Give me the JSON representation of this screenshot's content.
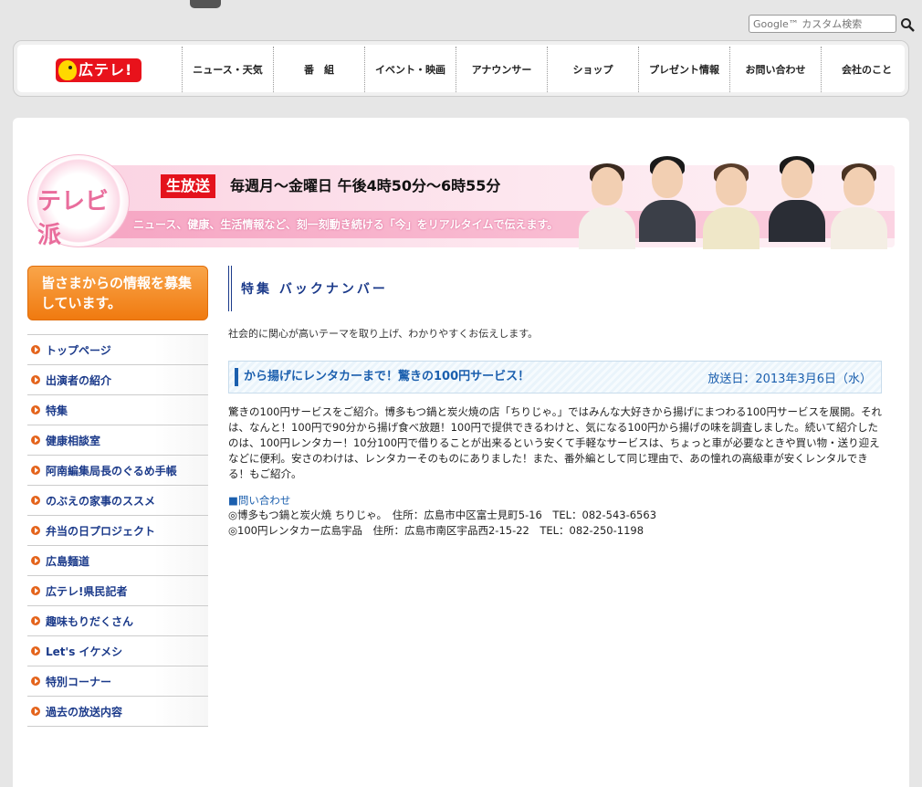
{
  "search": {
    "placeholder": "Google™ カスタム検索"
  },
  "logo": {
    "text": "広テレ!"
  },
  "nav": [
    "ニュース・天気",
    "番　組",
    "イベント・映画",
    "アナウンサー",
    "ショップ",
    "プレゼント情報",
    "お問い合わせ",
    "会社のこと"
  ],
  "banner": {
    "program_name": "テレビ派",
    "live_label": "生放送",
    "schedule": "毎週月～金曜日 午後4時50分～6時55分",
    "tagline": "ニュース、健康、生活情報など、刻一刻動き続ける「今」をリアルタイムで伝えます。"
  },
  "sidebar": {
    "info_banner": "皆さまからの情報を募集しています。",
    "items": [
      "トップページ",
      "出演者の紹介",
      "特集",
      "健康相談室",
      "阿南編集局長のぐるめ手帳",
      "のぶえの家事のススメ",
      "弁当の日プロジェクト",
      "広島麺道",
      "広テレ!県民記者",
      "趣味もりだくさん",
      "Let's イケメシ",
      "特別コーナー",
      "過去の放送内容"
    ]
  },
  "main": {
    "section_title": "特集 バックナンバー",
    "intro": "社会的に関心が高いテーマを取り上げ、わかりやすくお伝えします。",
    "feature": {
      "title": "から揚げにレンタカーまで！驚きの100円サービス！",
      "date": "放送日：2013年3月6日（水）",
      "body": "驚きの100円サービスをご紹介。博多もつ鍋と炭火焼の店「ちりじゃ。」ではみんな大好きから揚げにまつわる100円サービスを展開。それは、なんと！100円で90分から揚げ食べ放題！100円で提供できるわけと、気になる100円から揚げの味を調査しました。続いて紹介したのは、100円レンタカー！10分100円で借りることが出来るという安くて手軽なサービスは、ちょっと車が必要なときや買い物・送り迎えなどに便利。安さのわけは、レンタカーそのものにありました！また、番外編として同じ理由で、あの憧れの高級車が安くレンタルできる！もご紹介。",
      "contact_heading": "■問い合わせ",
      "contacts": [
        "◎博多もつ鍋と炭火焼 ちりじゃ。　住所：広島市中区富士見町5-16　TEL：082-543-6563",
        "◎100円レンタカー広島宇品　住所：広島市南区宇品西2-15-22　TEL：082-250-1198"
      ]
    }
  }
}
